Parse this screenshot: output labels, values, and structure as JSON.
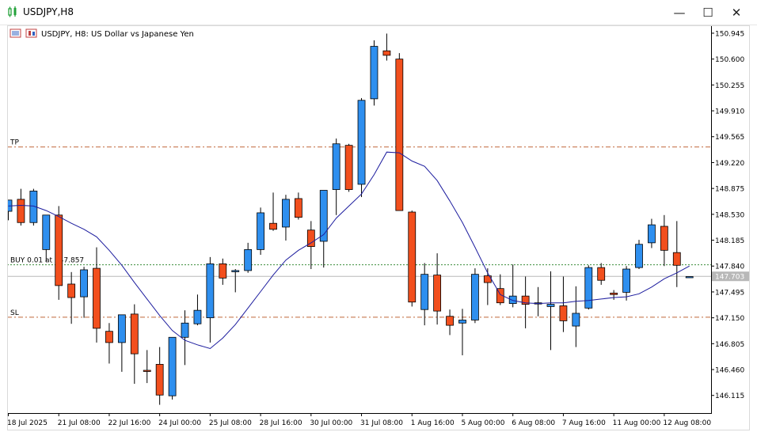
{
  "window": {
    "title": "USDJPY,H8",
    "buttons": {
      "minimize": "—",
      "maximize": "☐",
      "close": "✕"
    }
  },
  "chart_header": {
    "label": "USDJPY, H8:  US Dollar vs Japanese Yen"
  },
  "levels": {
    "tp": {
      "label": "TP",
      "price": 149.428
    },
    "buy": {
      "label": "BUY 0.01 at 147.857",
      "price": 147.857
    },
    "sl": {
      "label": "SL",
      "price": 147.158
    },
    "current": {
      "label": "147.703",
      "price": 147.703
    }
  },
  "colors": {
    "bull": "#2e8fef",
    "bear": "#f24f1d",
    "ma": "#1c1c9e",
    "tp_sl": "#c0673a",
    "buy": "#3a8c3a",
    "price_line": "#b8b8b8"
  },
  "chart_data": {
    "type": "candlestick",
    "symbol": "USDJPY",
    "timeframe": "H8",
    "ylim": [
      145.88,
      151.05
    ],
    "y_ticks": [
      "150.945",
      "150.600",
      "150.255",
      "149.910",
      "149.565",
      "149.220",
      "148.875",
      "148.530",
      "148.185",
      "147.840",
      "147.495",
      "147.150",
      "146.805",
      "146.460",
      "146.115"
    ],
    "x_ticks": [
      {
        "label": "18 Jul 2025",
        "index": 0
      },
      {
        "label": "21 Jul 08:00",
        "index": 4
      },
      {
        "label": "22 Jul 16:00",
        "index": 8
      },
      {
        "label": "24 Jul 00:00",
        "index": 12
      },
      {
        "label": "25 Jul 08:00",
        "index": 16
      },
      {
        "label": "28 Jul 16:00",
        "index": 20
      },
      {
        "label": "30 Jul 00:00",
        "index": 24
      },
      {
        "label": "31 Jul 08:00",
        "index": 28
      },
      {
        "label": "1 Aug 16:00",
        "index": 32
      },
      {
        "label": "5 Aug 00:00",
        "index": 36
      },
      {
        "label": "6 Aug 08:00",
        "index": 40
      },
      {
        "label": "7 Aug 16:00",
        "index": 44
      },
      {
        "label": "11 Aug 00:00",
        "index": 48
      },
      {
        "label": "12 Aug 08:00",
        "index": 52
      }
    ],
    "candles": [
      {
        "o": 148.57,
        "h": 148.72,
        "l": 148.45,
        "c": 148.72
      },
      {
        "o": 148.73,
        "h": 148.87,
        "l": 148.38,
        "c": 148.42
      },
      {
        "o": 148.42,
        "h": 148.87,
        "l": 148.38,
        "c": 148.84
      },
      {
        "o": 148.06,
        "h": 148.52,
        "l": 147.9,
        "c": 148.52
      },
      {
        "o": 148.52,
        "h": 148.64,
        "l": 147.39,
        "c": 147.58
      },
      {
        "o": 147.6,
        "h": 147.76,
        "l": 147.07,
        "c": 147.42
      },
      {
        "o": 147.43,
        "h": 147.83,
        "l": 147.15,
        "c": 147.79
      },
      {
        "o": 147.81,
        "h": 148.09,
        "l": 146.82,
        "c": 147.01
      },
      {
        "o": 146.97,
        "h": 147.08,
        "l": 146.54,
        "c": 146.82
      },
      {
        "o": 146.82,
        "h": 147.17,
        "l": 146.43,
        "c": 147.19
      },
      {
        "o": 147.2,
        "h": 147.33,
        "l": 146.27,
        "c": 146.67
      },
      {
        "o": 146.45,
        "h": 146.72,
        "l": 146.28,
        "c": 146.44
      },
      {
        "o": 146.53,
        "h": 146.76,
        "l": 145.99,
        "c": 146.12
      },
      {
        "o": 146.11,
        "h": 146.87,
        "l": 146.06,
        "c": 146.89
      },
      {
        "o": 146.89,
        "h": 147.25,
        "l": 146.52,
        "c": 147.08
      },
      {
        "o": 147.07,
        "h": 147.46,
        "l": 147.05,
        "c": 147.25
      },
      {
        "o": 147.15,
        "h": 147.96,
        "l": 146.82,
        "c": 147.87
      },
      {
        "o": 147.87,
        "h": 147.94,
        "l": 147.59,
        "c": 147.68
      },
      {
        "o": 147.77,
        "h": 147.8,
        "l": 147.49,
        "c": 147.78
      },
      {
        "o": 147.78,
        "h": 148.15,
        "l": 147.75,
        "c": 148.06
      },
      {
        "o": 148.06,
        "h": 148.62,
        "l": 147.99,
        "c": 148.55
      },
      {
        "o": 148.41,
        "h": 148.82,
        "l": 148.31,
        "c": 148.33
      },
      {
        "o": 148.36,
        "h": 148.79,
        "l": 148.18,
        "c": 148.73
      },
      {
        "o": 148.74,
        "h": 148.82,
        "l": 148.46,
        "c": 148.49
      },
      {
        "o": 148.32,
        "h": 148.44,
        "l": 147.8,
        "c": 148.1
      },
      {
        "o": 148.17,
        "h": 148.81,
        "l": 147.82,
        "c": 148.85
      },
      {
        "o": 148.86,
        "h": 149.54,
        "l": 148.52,
        "c": 149.47
      },
      {
        "o": 149.45,
        "h": 149.47,
        "l": 148.83,
        "c": 148.86
      },
      {
        "o": 148.93,
        "h": 150.08,
        "l": 148.76,
        "c": 150.05
      },
      {
        "o": 150.07,
        "h": 150.85,
        "l": 149.98,
        "c": 150.77
      },
      {
        "o": 150.71,
        "h": 150.94,
        "l": 150.58,
        "c": 150.65
      },
      {
        "o": 150.6,
        "h": 150.68,
        "l": 148.58,
        "c": 148.58
      },
      {
        "o": 148.56,
        "h": 148.58,
        "l": 147.3,
        "c": 147.36
      },
      {
        "o": 147.26,
        "h": 147.88,
        "l": 147.05,
        "c": 147.73
      },
      {
        "o": 147.72,
        "h": 148.01,
        "l": 147.06,
        "c": 147.24
      },
      {
        "o": 147.17,
        "h": 147.26,
        "l": 146.92,
        "c": 147.05
      },
      {
        "o": 147.08,
        "h": 147.27,
        "l": 146.65,
        "c": 147.12
      },
      {
        "o": 147.12,
        "h": 147.81,
        "l": 147.08,
        "c": 147.73
      },
      {
        "o": 147.71,
        "h": 147.81,
        "l": 147.32,
        "c": 147.62
      },
      {
        "o": 147.54,
        "h": 147.73,
        "l": 147.32,
        "c": 147.35
      },
      {
        "o": 147.34,
        "h": 147.86,
        "l": 147.29,
        "c": 147.44
      },
      {
        "o": 147.44,
        "h": 147.7,
        "l": 147.01,
        "c": 147.33
      },
      {
        "o": 147.34,
        "h": 147.56,
        "l": 147.17,
        "c": 147.35
      },
      {
        "o": 147.3,
        "h": 147.77,
        "l": 146.72,
        "c": 147.33
      },
      {
        "o": 147.31,
        "h": 147.7,
        "l": 146.96,
        "c": 147.11
      },
      {
        "o": 147.04,
        "h": 147.57,
        "l": 146.76,
        "c": 147.21
      },
      {
        "o": 147.28,
        "h": 147.85,
        "l": 147.26,
        "c": 147.82
      },
      {
        "o": 147.82,
        "h": 147.88,
        "l": 147.59,
        "c": 147.65
      },
      {
        "o": 147.48,
        "h": 147.52,
        "l": 147.39,
        "c": 147.46
      },
      {
        "o": 147.49,
        "h": 147.84,
        "l": 147.38,
        "c": 147.8
      },
      {
        "o": 147.82,
        "h": 148.19,
        "l": 147.8,
        "c": 148.13
      },
      {
        "o": 148.15,
        "h": 148.47,
        "l": 148.08,
        "c": 148.39
      },
      {
        "o": 148.37,
        "h": 148.52,
        "l": 147.84,
        "c": 148.05
      },
      {
        "o": 148.02,
        "h": 148.44,
        "l": 147.56,
        "c": 147.85
      },
      {
        "o": 147.7,
        "h": 147.7,
        "l": 147.7,
        "c": 147.7
      }
    ],
    "moving_average": [
      148.64,
      148.65,
      148.64,
      148.58,
      148.5,
      148.41,
      148.33,
      148.23,
      148.05,
      147.85,
      147.62,
      147.4,
      147.18,
      146.98,
      146.85,
      146.79,
      146.74,
      146.88,
      147.06,
      147.28,
      147.5,
      147.72,
      147.92,
      148.05,
      148.15,
      148.26,
      148.48,
      148.64,
      148.8,
      149.06,
      149.36,
      149.35,
      149.24,
      149.17,
      148.98,
      148.71,
      148.42,
      148.09,
      147.75,
      147.46,
      147.38,
      147.35,
      147.34,
      147.35,
      147.35,
      147.37,
      147.38,
      147.4,
      147.42,
      147.43,
      147.47,
      147.56,
      147.67,
      147.75,
      147.84
    ]
  }
}
